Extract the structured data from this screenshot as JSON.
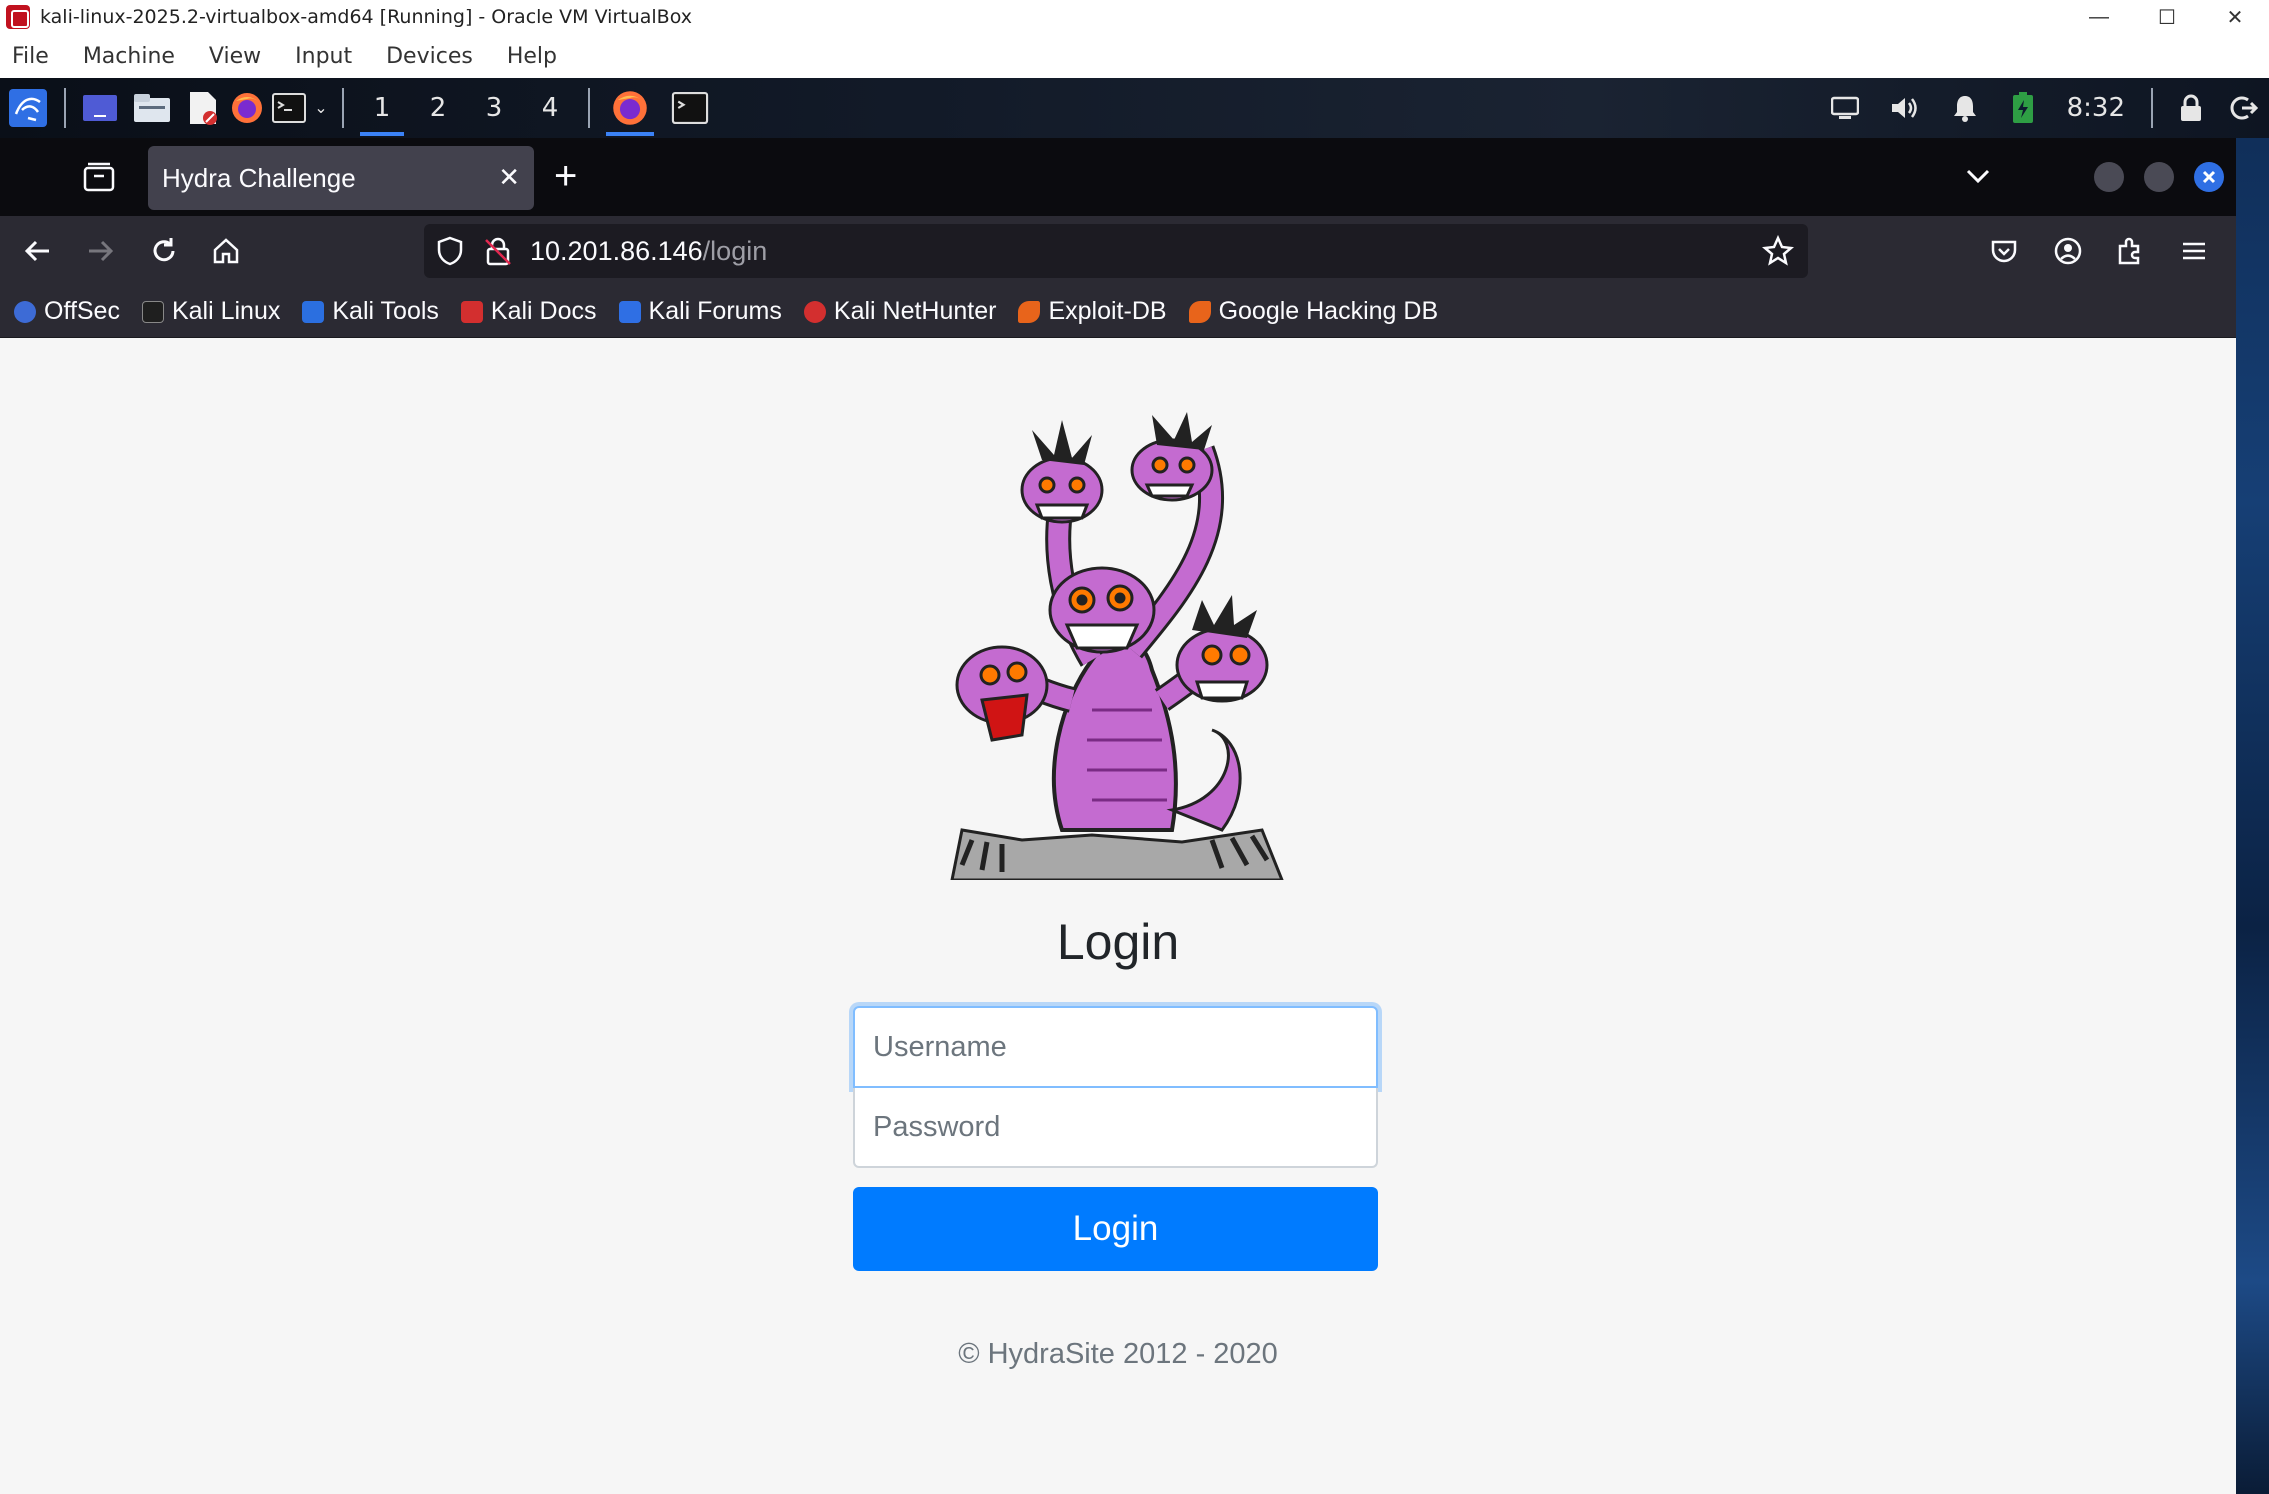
{
  "host_window": {
    "title": "kali-linux-2025.2-virtualbox-amd64 [Running] - Oracle VM VirtualBox",
    "controls": {
      "minimize": "—",
      "maximize": "☐",
      "close": "✕"
    }
  },
  "vbox_menu": {
    "items": [
      "File",
      "Machine",
      "View",
      "Input",
      "Devices",
      "Help"
    ]
  },
  "panel": {
    "workspaces": [
      "1",
      "2",
      "3",
      "4"
    ],
    "active_workspace": "1",
    "clock": "8:32"
  },
  "browser": {
    "tab": {
      "title": "Hydra Challenge",
      "close": "✕"
    },
    "new_tab": "+",
    "url": {
      "host": "10.201.86.146",
      "path": "/login"
    },
    "bookmarks": [
      {
        "label": "OffSec",
        "color": "#3d6bd6"
      },
      {
        "label": "Kali Linux",
        "color": "#1f1f1f"
      },
      {
        "label": "Kali Tools",
        "color": "#2b6fe0"
      },
      {
        "label": "Kali Docs",
        "color": "#d32f2f"
      },
      {
        "label": "Kali Forums",
        "color": "#2f6fe4"
      },
      {
        "label": "Kali NetHunter",
        "color": "#d32f2f"
      },
      {
        "label": "Exploit-DB",
        "color": "#e8641b"
      },
      {
        "label": "Google Hacking DB",
        "color": "#e8641b"
      }
    ]
  },
  "page": {
    "heading": "Login",
    "username_placeholder": "Username",
    "password_placeholder": "Password",
    "login_button": "Login",
    "footer": "© HydraSite 2012 - 2020"
  },
  "colors": {
    "accent": "#007bff",
    "focus_ring": "#80bdff",
    "tab_bg": "#42414d",
    "toolbar_bg": "#2b2a33"
  }
}
